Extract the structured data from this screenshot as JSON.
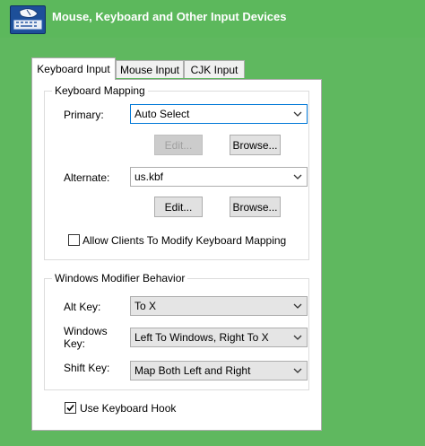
{
  "window": {
    "title": "Mouse, Keyboard and Other Input Devices",
    "app_icon": "mouse-keyboard-icon"
  },
  "tabs": [
    {
      "label": "Keyboard Input",
      "active": true
    },
    {
      "label": "Mouse Input",
      "active": false
    },
    {
      "label": "CJK Input",
      "active": false
    }
  ],
  "keyboard_mapping": {
    "group_title": "Keyboard Mapping",
    "primary_label": "Primary:",
    "primary_value": "Auto Select",
    "primary_edit": "Edit...",
    "primary_browse": "Browse...",
    "alternate_label": "Alternate:",
    "alternate_value": "us.kbf",
    "alternate_edit": "Edit...",
    "alternate_browse": "Browse...",
    "allow_clients_label": "Allow Clients To Modify Keyboard Mapping",
    "allow_clients_checked": false
  },
  "modifier": {
    "group_title": "Windows Modifier Behavior",
    "alt_label": "Alt Key:",
    "alt_value": "To X",
    "windows_label_line1": "Windows",
    "windows_label_line2": "Key:",
    "windows_value": "Left To Windows, Right To X",
    "shift_label": "Shift Key:",
    "shift_value": "Map Both Left and Right"
  },
  "use_hook": {
    "label": "Use Keyboard Hook",
    "checked": true
  },
  "colors": {
    "titlebar": "#5cb85c",
    "focus": "#0078d7"
  }
}
